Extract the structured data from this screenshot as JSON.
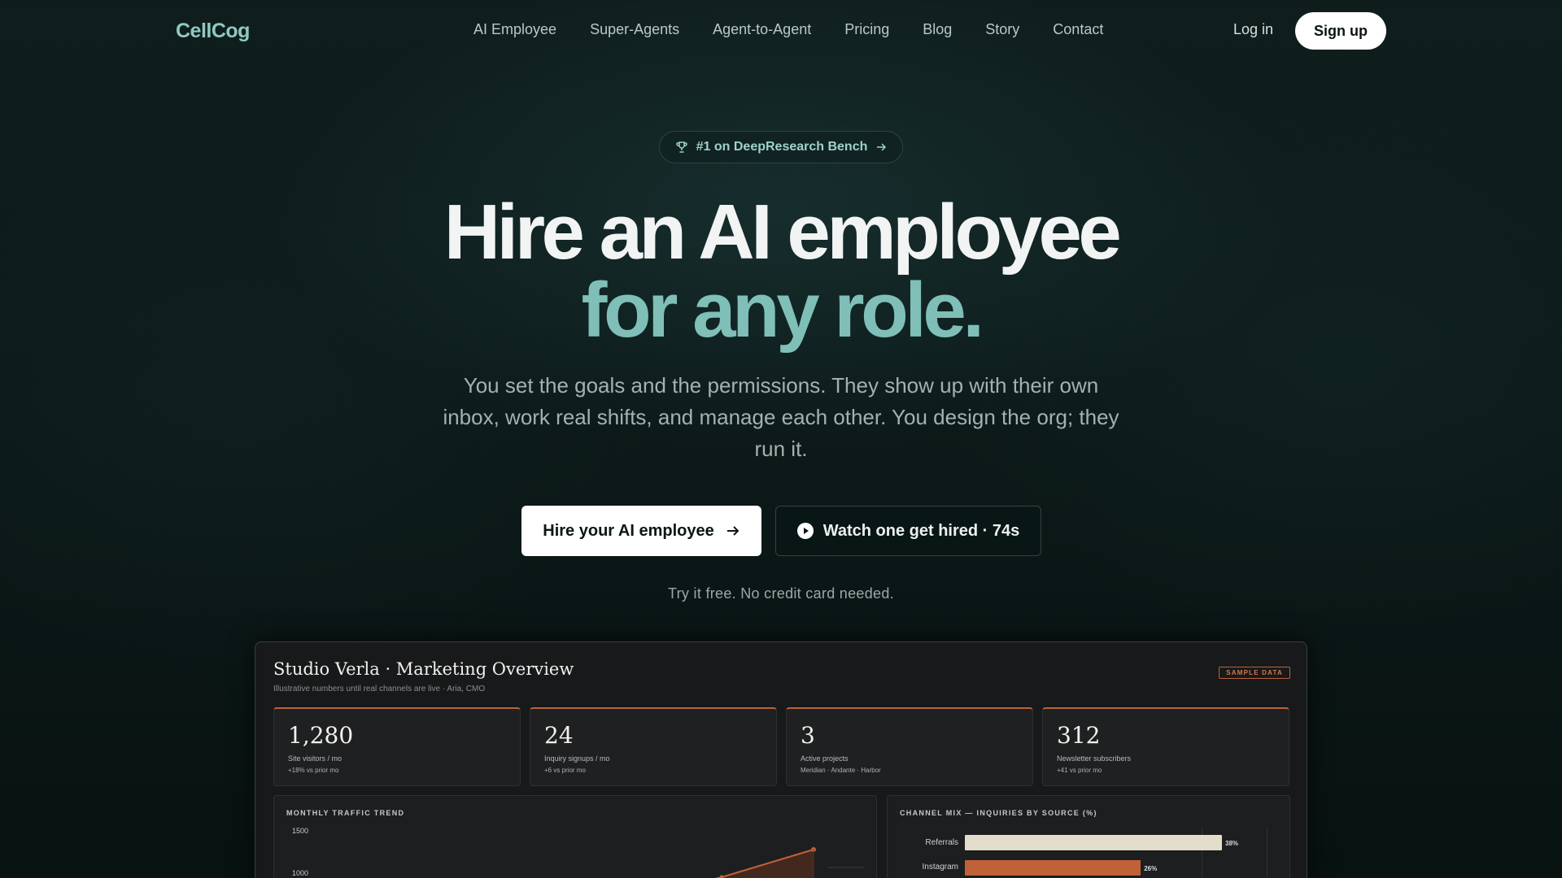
{
  "nav": {
    "logo": "CellCog",
    "links": [
      "AI Employee",
      "Super-Agents",
      "Agent-to-Agent",
      "Pricing",
      "Blog",
      "Story",
      "Contact"
    ],
    "login": "Log in",
    "signup": "Sign up"
  },
  "hero": {
    "badge": "#1 on DeepResearch Bench",
    "title_line1": "Hire an AI employee",
    "title_line2": "for any role.",
    "subtitle": "You set the goals and the permissions. They show up with their own inbox, work real shifts, and manage each other. You design the org; they run it.",
    "cta_primary": "Hire your AI employee",
    "cta_secondary": "Watch one get hired · 74s",
    "note": "Try it free. No credit card needed."
  },
  "dashboard": {
    "title": "Studio Verla · Marketing Overview",
    "subtitle": "Illustrative numbers until real channels are live · Aria, CMO",
    "sample_tag": "SAMPLE DATA",
    "kpis": [
      {
        "value": "1,280",
        "label": "Site visitors / mo",
        "delta": "+18% vs prior mo"
      },
      {
        "value": "24",
        "label": "Inquiry signups / mo",
        "delta": "+6 vs prior mo"
      },
      {
        "value": "3",
        "label": "Active projects",
        "delta": "Meridian · Andante · Harbor"
      },
      {
        "value": "312",
        "label": "Newsletter subscribers",
        "delta": "+41 vs prior mo"
      }
    ],
    "traffic": {
      "heading": "MONTHLY TRAFFIC TREND",
      "y_ticks": [
        "1500",
        "1000"
      ]
    },
    "mix": {
      "heading": "CHANNEL MIX — INQUIRIES BY SOURCE (%)",
      "bars": [
        {
          "label": "Referrals",
          "value": 38,
          "display": "38%",
          "color": "#e3dccb"
        },
        {
          "label": "Instagram",
          "value": 26,
          "display": "26%",
          "color": "#c0613a"
        }
      ]
    }
  },
  "colors": {
    "accent": "#7fbfb8",
    "dashboard_accent": "#b8643a"
  }
}
